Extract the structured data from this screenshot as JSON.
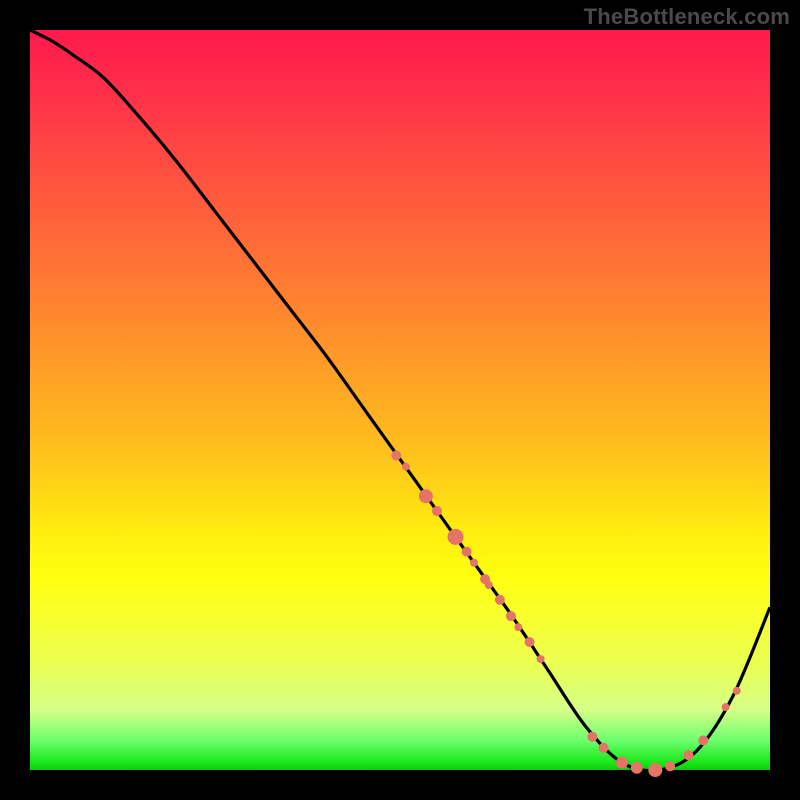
{
  "watermark": "TheBottleneck.com",
  "colors": {
    "background": "#000000",
    "gradient_top": "#ff1a4d",
    "gradient_bottom": "#10c810",
    "curve": "#000000",
    "dots": "#e57368"
  },
  "chart_data": {
    "type": "line",
    "title": "",
    "xlabel": "",
    "ylabel": "",
    "xlim": [
      0,
      100
    ],
    "ylim": [
      0,
      100
    ],
    "x": [
      0,
      3,
      6,
      10,
      15,
      20,
      25,
      30,
      35,
      40,
      45,
      50,
      55,
      60,
      65,
      70,
      75,
      80,
      85,
      90,
      95,
      100
    ],
    "values": [
      100,
      98.5,
      96.5,
      93.5,
      88,
      82,
      75.5,
      69,
      62.5,
      56,
      49,
      42,
      35,
      28,
      21,
      13.5,
      6,
      1,
      0,
      2.5,
      10,
      22
    ],
    "dots": [
      {
        "x": 49.5,
        "y": 42.5,
        "r": 5
      },
      {
        "x": 50.8,
        "y": 41,
        "r": 4
      },
      {
        "x": 53.5,
        "y": 37,
        "r": 7
      },
      {
        "x": 55.0,
        "y": 35,
        "r": 5
      },
      {
        "x": 57.5,
        "y": 31.5,
        "r": 8
      },
      {
        "x": 59.0,
        "y": 29.5,
        "r": 5
      },
      {
        "x": 60.0,
        "y": 28,
        "r": 4
      },
      {
        "x": 61.5,
        "y": 25.8,
        "r": 5
      },
      {
        "x": 62.0,
        "y": 25,
        "r": 4
      },
      {
        "x": 63.5,
        "y": 23,
        "r": 5
      },
      {
        "x": 65.0,
        "y": 20.8,
        "r": 5
      },
      {
        "x": 66.0,
        "y": 19.3,
        "r": 4
      },
      {
        "x": 67.5,
        "y": 17.3,
        "r": 5
      },
      {
        "x": 69.0,
        "y": 15,
        "r": 4
      },
      {
        "x": 76.0,
        "y": 4.5,
        "r": 5
      },
      {
        "x": 77.5,
        "y": 3,
        "r": 5
      },
      {
        "x": 80.0,
        "y": 1,
        "r": 6
      },
      {
        "x": 82.0,
        "y": 0.3,
        "r": 6
      },
      {
        "x": 84.5,
        "y": 0,
        "r": 7
      },
      {
        "x": 86.5,
        "y": 0.5,
        "r": 5
      },
      {
        "x": 89.0,
        "y": 2,
        "r": 5
      },
      {
        "x": 91.0,
        "y": 4,
        "r": 5
      },
      {
        "x": 94.0,
        "y": 8.5,
        "r": 4
      },
      {
        "x": 95.5,
        "y": 10.7,
        "r": 4
      }
    ]
  }
}
